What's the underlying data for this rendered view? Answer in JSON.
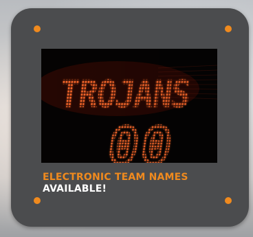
{
  "sign": {
    "led_text": "TROJANS",
    "led_digits": "00"
  },
  "caption": {
    "line1": "ELECTRONIC TEAM NAMES",
    "line2": "AVAILABLE!"
  },
  "colors": {
    "accent": "#f08a1e",
    "panel": "#4b4c4e",
    "led": "#ff5a2a"
  }
}
